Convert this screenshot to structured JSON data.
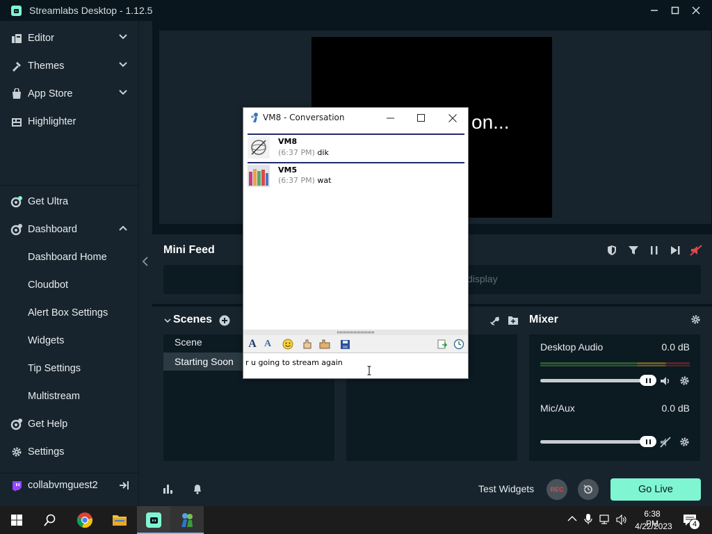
{
  "window": {
    "title": "Streamlabs Desktop - 1.12.5"
  },
  "sidebar": {
    "items": [
      {
        "label": "Editor",
        "icon": "editor-icon",
        "chevron": "down"
      },
      {
        "label": "Themes",
        "icon": "themes-icon",
        "chevron": "down"
      },
      {
        "label": "App Store",
        "icon": "app-store-icon",
        "chevron": "down"
      },
      {
        "label": "Highlighter",
        "icon": "highlighter-icon"
      }
    ],
    "lower_items": [
      {
        "label": "Get Ultra",
        "icon": "ultra-icon"
      },
      {
        "label": "Dashboard",
        "icon": "dashboard-icon",
        "chevron": "up"
      },
      {
        "label": "Dashboard Home"
      },
      {
        "label": "Cloudbot"
      },
      {
        "label": "Alert Box Settings"
      },
      {
        "label": "Widgets"
      },
      {
        "label": "Tip Settings"
      },
      {
        "label": "Multistream"
      },
      {
        "label": "Get Help",
        "icon": "help-icon"
      },
      {
        "label": "Settings",
        "icon": "gear-icon"
      }
    ],
    "user": "collabvmguest2"
  },
  "preview": {
    "text": "on..."
  },
  "minifeed": {
    "title": "Mini Feed",
    "body_text": "display"
  },
  "scenes": {
    "title": "Scenes",
    "items": [
      "Scene",
      "Starting Soon"
    ],
    "selected": "Starting Soon"
  },
  "mixer": {
    "title": "Mixer",
    "sources": [
      {
        "name": "Desktop Audio",
        "level": "0.0 dB",
        "volume": 1.0,
        "muted": false
      },
      {
        "name": "Mic/Aux",
        "level": "0.0 dB",
        "volume": 1.0,
        "muted": true
      }
    ]
  },
  "footer": {
    "test_widgets": "Test Widgets",
    "rec": "REC",
    "go_live": "Go Live"
  },
  "conversation": {
    "title": "VM8 - Conversation",
    "messages": [
      {
        "sender": "VM8",
        "time": "(6:37 PM)",
        "text": "dik"
      },
      {
        "sender": "VM5",
        "time": "(6:37 PM)",
        "text": "wat"
      }
    ],
    "input_value": "r u going to stream again"
  },
  "taskbar": {
    "time": "6:38 PM",
    "date": "4/22/2023",
    "notifications": "4"
  },
  "colors": {
    "accent": "#80f5d2",
    "background": "#17242d",
    "dark": "#09161d",
    "rec": "#e0484b"
  }
}
